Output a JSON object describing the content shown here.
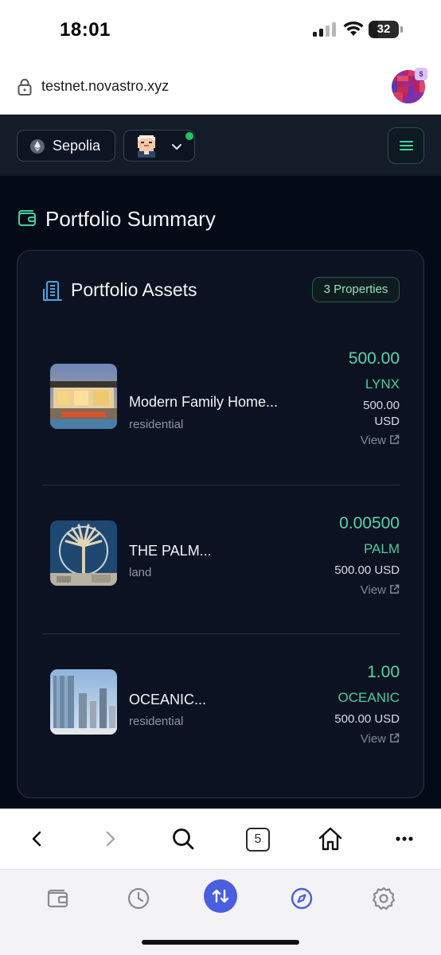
{
  "status_bar": {
    "time": "18:01",
    "battery": "32",
    "battery_level": 0.32
  },
  "browser": {
    "url": "testnet.novastro.xyz",
    "tabs_count": "5",
    "badge": "$"
  },
  "header": {
    "network": "Sepolia",
    "account_online": true
  },
  "page": {
    "title": "Portfolio Summary"
  },
  "portfolio": {
    "title": "Portfolio Assets",
    "count_badge": "3 Properties",
    "assets": [
      {
        "name": "Modern Family Home...",
        "category": "residential",
        "amount": "500.00",
        "symbol": "LYNX",
        "usd_line1": "500.00",
        "usd_line2": "USD",
        "view_label": "View"
      },
      {
        "name": "THE PALM...",
        "category": "land",
        "amount": "0.00500",
        "symbol": "PALM",
        "usd_line1": "500.00 USD",
        "view_label": "View"
      },
      {
        "name": "OCEANIC...",
        "category": "residential",
        "amount": "1.00",
        "symbol": "OCEANIC",
        "usd_line1": "500.00 USD",
        "view_label": "View"
      }
    ]
  },
  "colors": {
    "accent_green": "#58d4a8",
    "app_bg": "#050a17",
    "nav_active": "#4a5ee0"
  },
  "icons": {
    "toolbar": [
      "back-icon",
      "forward-icon",
      "search-icon",
      "tabs-icon",
      "home-icon",
      "more-icon"
    ],
    "bottom_nav": [
      "wallet-icon",
      "history-icon",
      "swap-icon",
      "explore-icon",
      "settings-icon"
    ]
  }
}
